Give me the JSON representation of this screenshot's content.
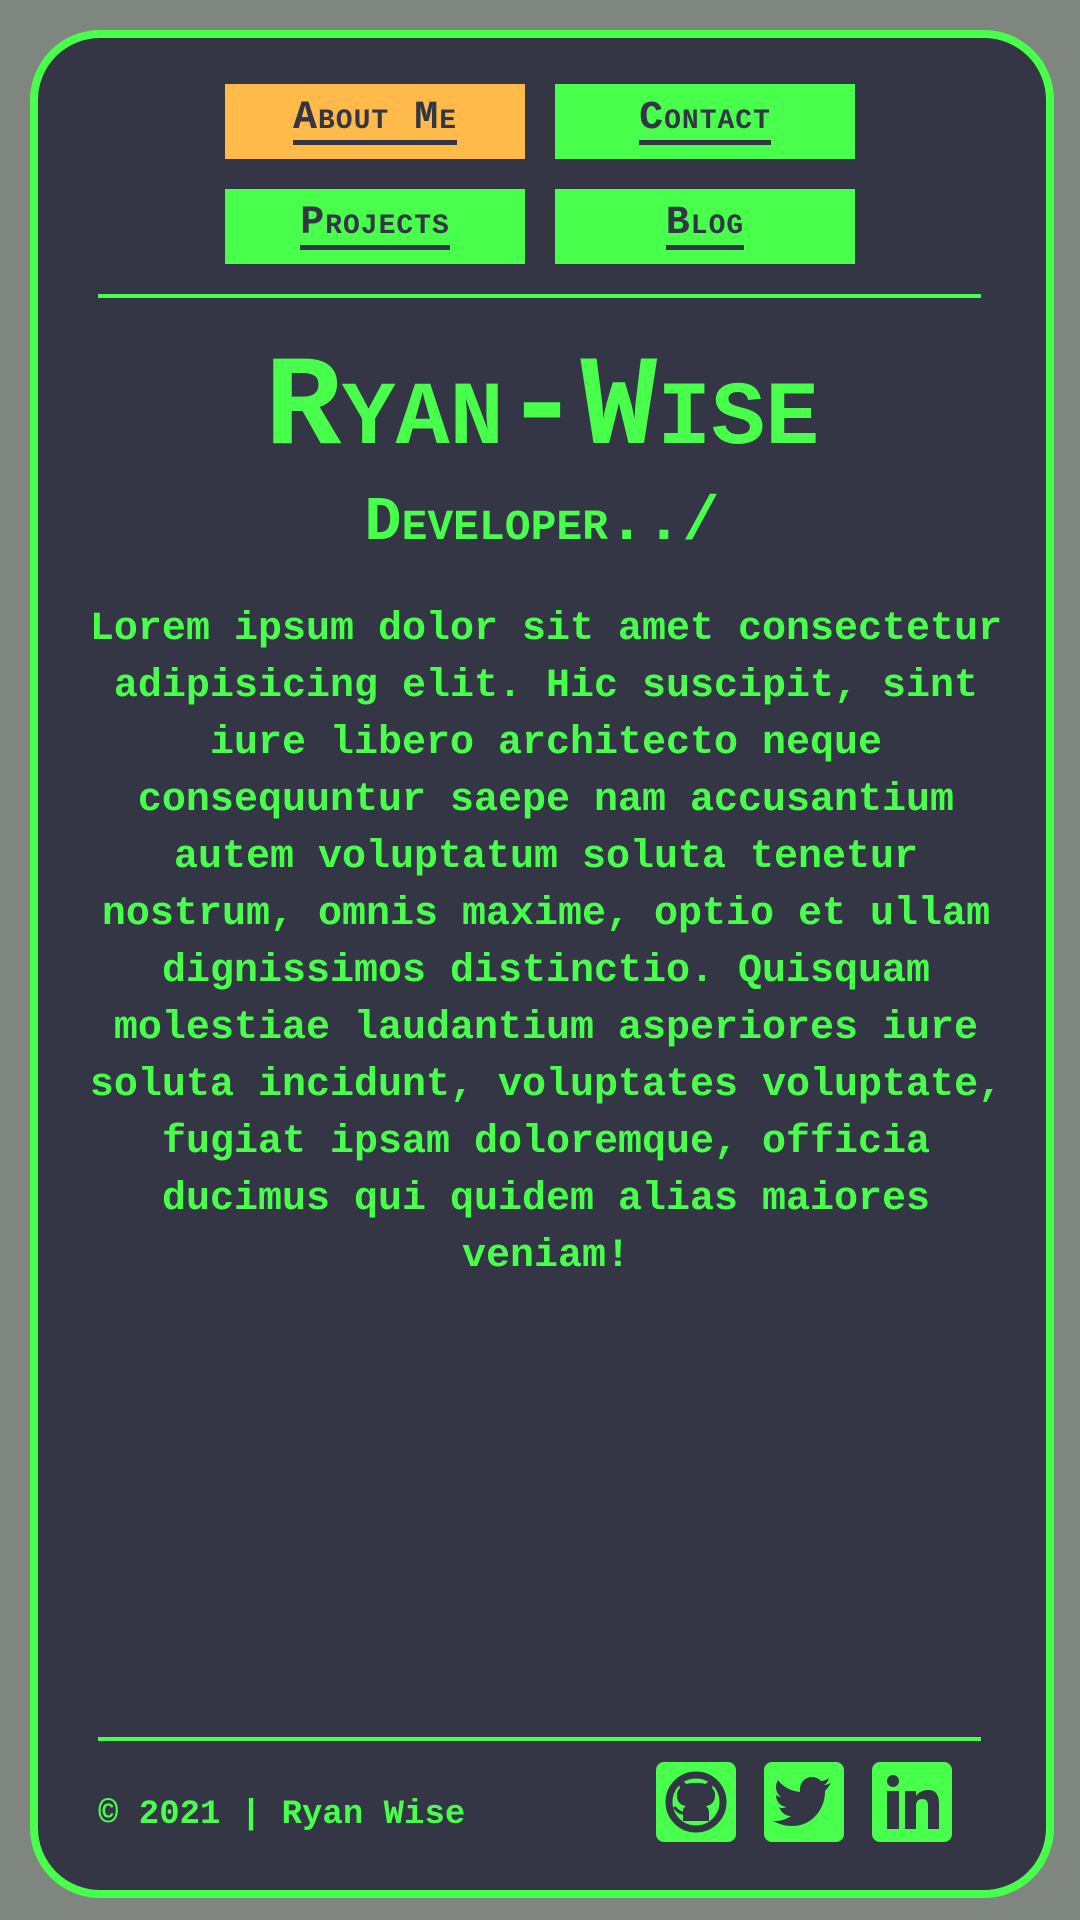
{
  "nav": {
    "items": [
      {
        "label": "About Me",
        "active": true
      },
      {
        "label": "Contact",
        "active": false
      },
      {
        "label": "Projects",
        "active": false
      },
      {
        "label": "Blog",
        "active": false
      }
    ]
  },
  "hero": {
    "name": "Ryan-Wise",
    "role": "Developer../",
    "bio": "Lorem ipsum dolor sit amet consectetur adipisicing elit. Hic suscipit, sint iure libero architecto neque consequuntur saepe nam accusantium autem voluptatum soluta tenetur nostrum, omnis maxime, optio et ullam dignissimos distinctio. Quisquam molestiae laudantium asperiores iure soluta incidunt, voluptates voluptate, fugiat ipsam doloremque, officia ducimus qui quidem alias maiores veniam!"
  },
  "footer": {
    "copyright": "© 2021 | Ryan Wise",
    "social": [
      {
        "icon": "github-icon"
      },
      {
        "icon": "twitter-icon"
      },
      {
        "icon": "linkedin-icon"
      }
    ]
  },
  "colors": {
    "page_background": "#7f8680",
    "card_background": "#343645",
    "accent_green": "#48ff4c",
    "active_orange": "#ffba4a"
  }
}
